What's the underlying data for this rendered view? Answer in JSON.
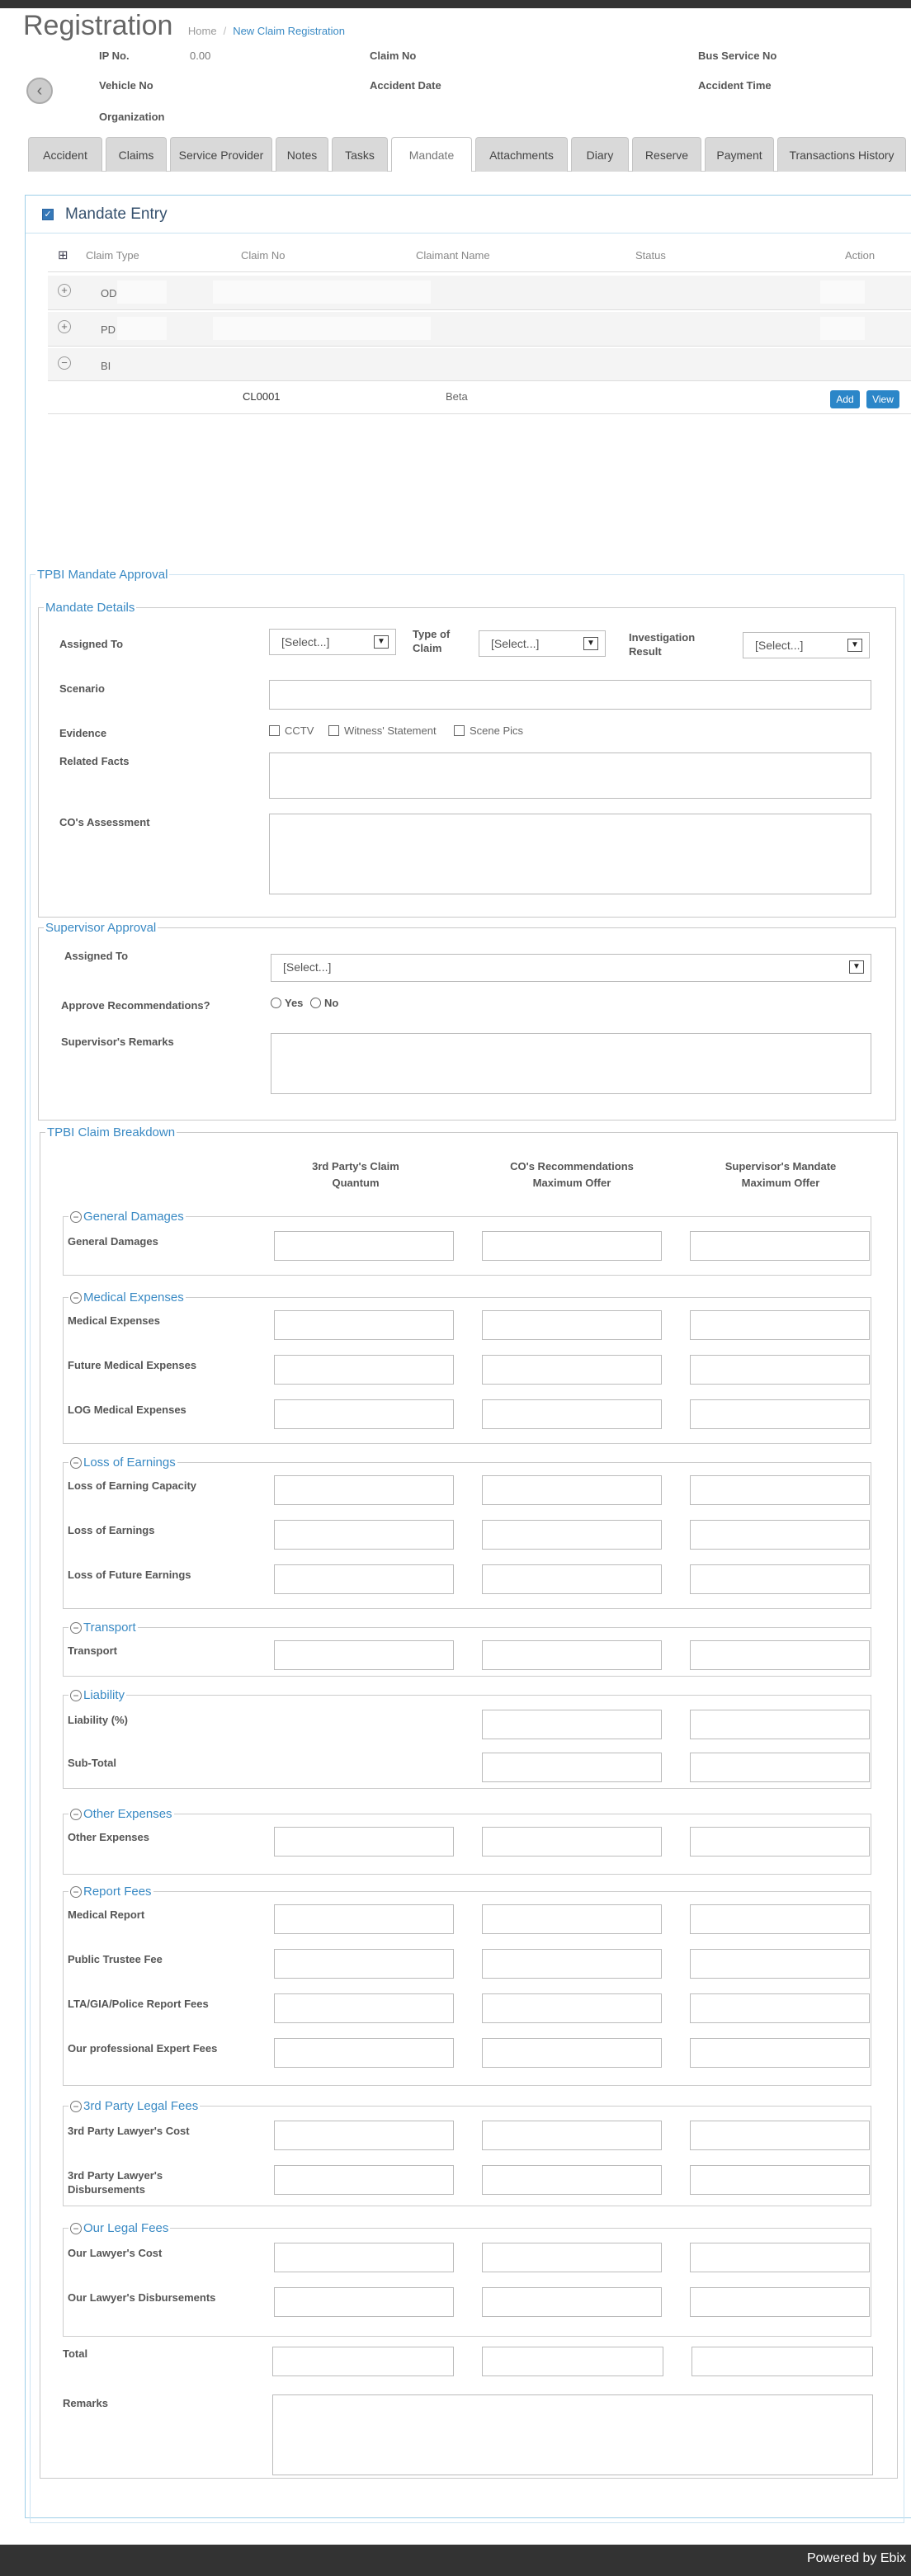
{
  "page": {
    "title": "Registration"
  },
  "breadcrumb": {
    "home": "Home",
    "current": "New Claim Registration"
  },
  "header_info": {
    "ip_no_label": "IP No.",
    "ip_no_value": "0.00",
    "claim_no_label": "Claim No",
    "bus_service_no_label": "Bus Service No",
    "vehicle_no_label": "Vehicle No",
    "accident_date_label": "Accident Date",
    "accident_time_label": "Accident Time",
    "organization_label": "Organization"
  },
  "tabs": [
    "Accident",
    "Claims",
    "Service Provider",
    "Notes",
    "Tasks",
    "Mandate",
    "Attachments",
    "Diary",
    "Reserve",
    "Payment",
    "Transactions History"
  ],
  "active_tab": "Mandate",
  "mandate_entry": {
    "title": "Mandate Entry",
    "columns": {
      "claim_type": "Claim Type",
      "claim_no": "Claim No",
      "claimant_name": "Claimant Name",
      "status": "Status",
      "action": "Action"
    },
    "rows": [
      {
        "type": "OD"
      },
      {
        "type": "PD"
      },
      {
        "type": "BI"
      }
    ],
    "sub_row": {
      "claim_no": "CL0001",
      "claimant_name": "Beta",
      "add": "Add",
      "view": "View"
    }
  },
  "tpbi": {
    "title": "TPBI Mandate Approval",
    "mandate_details": {
      "legend": "Mandate Details",
      "assigned_to": "Assigned To",
      "type_of_claim": "Type of Claim",
      "investigation_result": "Investigation Result",
      "select_placeholder": "[Select...]",
      "scenario": "Scenario",
      "evidence": "Evidence",
      "cctv": "CCTV",
      "witness": "Witness' Statement",
      "scene_pics": "Scene Pics",
      "related_facts": "Related Facts",
      "co_assessment": "CO's Assessment"
    },
    "supervisor": {
      "legend": "Supervisor Approval",
      "assigned_to": "Assigned To",
      "select_placeholder": "[Select...]",
      "approve": "Approve Recommendations?",
      "yes": "Yes",
      "no": "No",
      "remarks": "Supervisor's Remarks"
    },
    "breakdown": {
      "legend": "TPBI Claim Breakdown",
      "col1": "3rd Party's Claim Quantum",
      "col2": "CO's Recommendations Maximum Offer",
      "col3": "Supervisor's Mandate Maximum Offer",
      "groups": {
        "general": {
          "legend": "General Damages",
          "items": [
            "General Damages"
          ]
        },
        "medical": {
          "legend": "Medical Expenses",
          "items": [
            "Medical Expenses",
            "Future Medical Expenses",
            "LOG Medical Expenses"
          ]
        },
        "earnings": {
          "legend": "Loss of Earnings",
          "items": [
            "Loss of Earning Capacity",
            "Loss of Earnings",
            "Loss of Future Earnings"
          ]
        },
        "transport": {
          "legend": "Transport",
          "items": [
            "Transport"
          ]
        },
        "liability": {
          "legend": "Liability",
          "items": [
            "Liability (%)",
            "Sub-Total"
          ]
        },
        "other": {
          "legend": "Other Expenses",
          "items": [
            "Other Expenses"
          ]
        },
        "report": {
          "legend": "Report Fees",
          "items": [
            "Medical Report",
            "Public Trustee Fee",
            "LTA/GIA/Police Report Fees",
            "Our professional Expert Fees"
          ]
        },
        "tp_legal": {
          "legend": "3rd Party Legal Fees",
          "items": [
            "3rd Party Lawyer's Cost",
            "3rd Party Lawyer's Disbursements"
          ]
        },
        "our_legal": {
          "legend": "Our Legal Fees",
          "items": [
            "Our Lawyer's Cost",
            "Our Lawyer's Disbursements"
          ]
        }
      },
      "total": "Total",
      "remarks": "Remarks"
    }
  },
  "footer": {
    "powered_by": "Powered by Ebix"
  }
}
